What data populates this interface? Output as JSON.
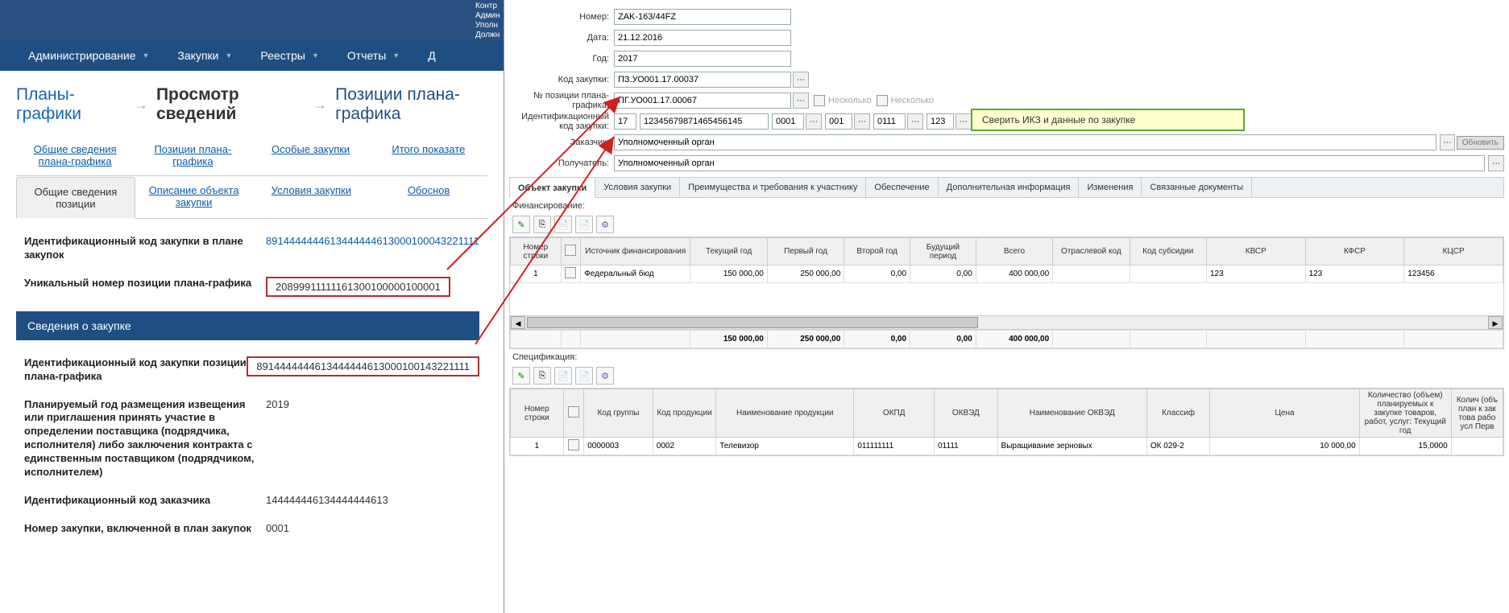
{
  "top_strip": [
    "Контр",
    "Админ",
    "Уполн",
    "Должн"
  ],
  "main_menu": {
    "items": [
      "Администрирование",
      "Закупки",
      "Реестры",
      "Отчеты",
      "Д"
    ]
  },
  "breadcrumb": {
    "a": "Планы-графики",
    "b": "Просмотр сведений",
    "c": "Позиции плана-графика"
  },
  "tabs1": {
    "a": "Общие сведения плана-графика",
    "b": "Позиции плана-графика",
    "c": "Особые закупки",
    "d": "Итого показате"
  },
  "tabs2": {
    "a": "Общие сведения позиции",
    "b": "Описание объекта закупки",
    "c": "Условия закупки",
    "d": "Обоснов"
  },
  "left": {
    "l_ikz_plan": "Идентификационный код закупки в плане закупок",
    "v_ikz_plan": "8914444444613444444613000100043221111",
    "l_unq": "Уникальный номер позиции плана-графика",
    "v_unq": "20899911111161300100000100001",
    "section": "Сведения о закупке",
    "l_ikz_pos": "Идентификационный код закупки позиции плана-графика",
    "v_ikz_pos": "8914444444613444444613000100143221111",
    "l_year": "Планируемый год размещения извещения или приглашения принять участие в определении поставщика (подрядчика, исполнителя) либо заключения контракта с единственным поставщиком (подрядчиком, исполнителем)",
    "v_year": "2019",
    "l_cust": "Идентификационный код заказчика",
    "v_cust": "144444446134444444613",
    "l_num": "Номер закупки, включенной в план закупок",
    "v_num": "0001"
  },
  "form": {
    "l_num": "Номер:",
    "v_num": "ZAK-163/44FZ",
    "l_date": "Дата:",
    "v_date": "21.12.2016",
    "l_year": "Год:",
    "v_year": "2017",
    "l_kz": "Код закупки:",
    "v_kz": "ПЗ.УО001.17.00037",
    "l_pos": "№ позиции плана-графика:",
    "v_pos": "ПГ.УО001.17.00067",
    "l_ikz": "Идентификационный код закупки:",
    "ikz": {
      "a": "17",
      "b": "12345679871465456145",
      "c": "0001",
      "d": "001",
      "e": "0111",
      "f": "123"
    },
    "multi": "Несколько",
    "l_cust": "Заказчик:",
    "v_cust": "Уполномоченный орган",
    "l_recv": "Получатель:",
    "v_recv": "Уполномоченный орган",
    "refresh": "Обновить"
  },
  "tip": "Сверить ИКЗ и данные по закупке",
  "subtabs": {
    "a": "Объект закупки",
    "b": "Условия закупки",
    "c": "Преимущества и требования к участнику",
    "d": "Обеспечение",
    "e": "Дополнительная информация",
    "f": "Изменения",
    "g": "Связанные документы"
  },
  "fin": {
    "title": "Финансирование:",
    "headers": {
      "row": "Номер строки",
      "src": "Источник финансирования",
      "cur": "Текущий год",
      "y1": "Первый год",
      "y2": "Второй год",
      "fut": "Будущий период",
      "total": "Всего",
      "otr": "Отраслевой код",
      "sub": "Код субсидии",
      "kvsr": "КВСР",
      "kfsr": "КФСР",
      "kcsr": "КЦСР"
    },
    "row": {
      "n": "1",
      "src": "Федеральный бюд",
      "cur": "150 000,00",
      "y1": "250 000,00",
      "y2": "0,00",
      "fut": "0,00",
      "total": "400 000,00",
      "otr": "",
      "sub": "",
      "kvsr": "123",
      "kfsr": "123",
      "kcsr": "123456"
    },
    "totals": {
      "cur": "150 000,00",
      "y1": "250 000,00",
      "y2": "0,00",
      "fut": "0,00",
      "total": "400 000,00"
    }
  },
  "spec": {
    "title": "Спецификация:",
    "headers": {
      "row": "Номер строки",
      "grp": "Код группы",
      "kp": "Код продукции",
      "name": "Наименование продукции",
      "okpd": "ОКПД",
      "okved": "ОКВЭД",
      "okved_name": "Наименование ОКВЭД",
      "class": "Классиф",
      "price": "Цена",
      "qty": "Количество (объем) планируемых к закупке товаров, работ, услуг: Текущий год",
      "qty2": "Колич (объ план к зак това рабо усл Перв"
    },
    "row": {
      "n": "1",
      "grp": "0000003",
      "kp": "0002",
      "name": "Телевизор",
      "okpd": "011111111",
      "okved": "01111",
      "okved_name": "Выращивание зерновых",
      "class": "ОК 029-2",
      "price": "10 000,00",
      "qty": "15,0000"
    }
  }
}
